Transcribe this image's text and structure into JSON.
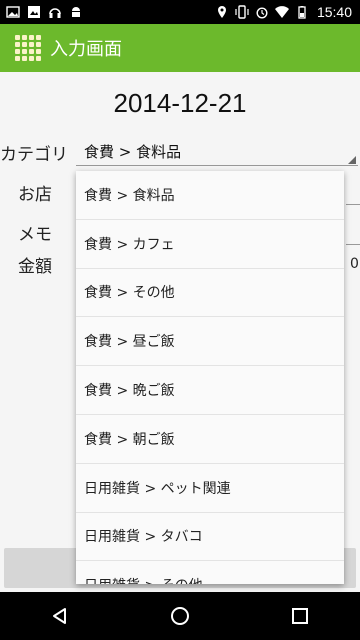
{
  "status_bar": {
    "time": "15:40",
    "left_icons": [
      "image-icon",
      "photo-icon",
      "headphones-icon",
      "android-icon"
    ],
    "right_icons": [
      "location-icon",
      "vibrate-icon",
      "alarm-icon",
      "wifi-icon",
      "battery-icon"
    ]
  },
  "app_bar": {
    "title": "入力画面",
    "icon": "grid-app-icon",
    "color": "#6cb92c"
  },
  "form": {
    "date": "2014-12-21",
    "category_label": "カテゴリ",
    "category_value": "食費 > 食料品",
    "shop_label": "お店",
    "memo_label": "メモ",
    "amount_label": "金額",
    "amount_value_partial": "0"
  },
  "dropdown": {
    "items": [
      "食費 > 食料品",
      "食費 > カフェ",
      "食費 > その他",
      "食費 > 昼ご飯",
      "食費 > 晩ご飯",
      "食費 > 朝ご飯",
      "日用雑貨 > ペット関連",
      "日用雑貨 > タバコ",
      "日用雑貨 > その他"
    ]
  },
  "nav_bar": {
    "buttons": [
      "back-icon",
      "home-icon",
      "recents-icon"
    ]
  }
}
